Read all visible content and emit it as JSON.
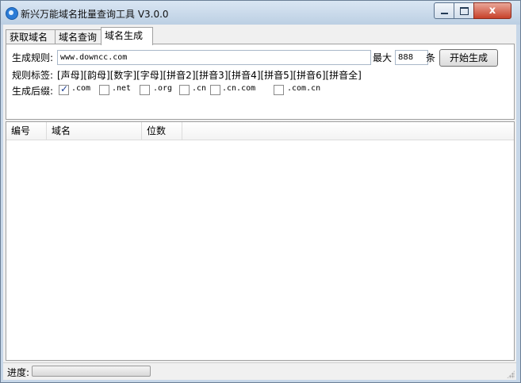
{
  "window": {
    "title": "新兴万能域名批量查询工具 V3.0.0",
    "close_label": "x"
  },
  "tabs": [
    {
      "label": "获取域名"
    },
    {
      "label": "域名查询"
    },
    {
      "label": "域名生成"
    }
  ],
  "generator": {
    "rule_label": "生成规则:",
    "rule_value": "www.downcc.com",
    "max_label": "最大",
    "max_value": "888",
    "count_unit": "条",
    "start_button": "开始生成",
    "tags_label": "规则标签:",
    "tags": [
      "[声母]",
      "[韵母]",
      "[数字]",
      "[字母]",
      "[拼音2]",
      "[拼音3]",
      "[拼音4]",
      "[拼音5]",
      "[拼音6]",
      "[拼音全]"
    ],
    "suffix_label": "生成后缀:",
    "suffixes": [
      {
        "label": ".com",
        "checked": true
      },
      {
        "label": ".net",
        "checked": false
      },
      {
        "label": ".org",
        "checked": false
      },
      {
        "label": ".cn",
        "checked": false
      },
      {
        "label": ".cn.com",
        "checked": false
      },
      {
        "label": ".com.cn",
        "checked": false
      }
    ]
  },
  "list": {
    "columns": [
      "编号",
      "域名",
      "位数"
    ],
    "rows": []
  },
  "status": {
    "progress_label": "进度:",
    "progress": 0
  }
}
